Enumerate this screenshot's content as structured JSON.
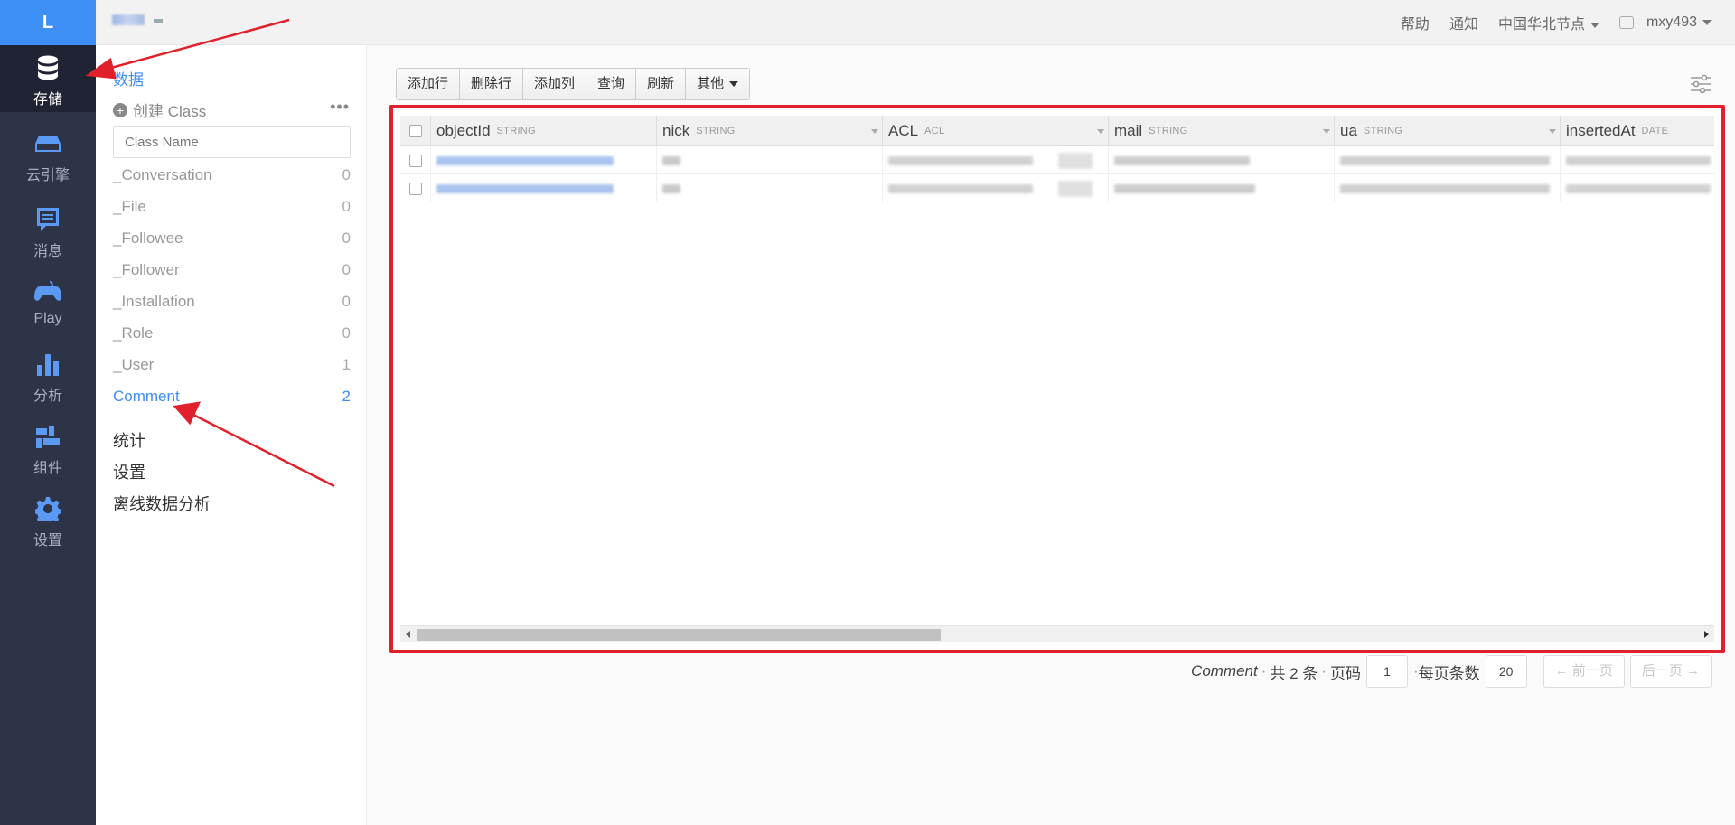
{
  "nav": {
    "logo": "L",
    "items": [
      {
        "label": "存储",
        "icon": "database-icon",
        "active": true
      },
      {
        "label": "云引擎",
        "icon": "cloud-engine-icon"
      },
      {
        "label": "消息",
        "icon": "message-icon"
      },
      {
        "label": "Play",
        "icon": "gamepad-icon"
      },
      {
        "label": "分析",
        "icon": "bar-chart-icon"
      },
      {
        "label": "组件",
        "icon": "components-icon"
      },
      {
        "label": "设置",
        "icon": "gear-icon"
      }
    ]
  },
  "topbar": {
    "help": "帮助",
    "notify": "通知",
    "region": "中国华北节点",
    "user": "mxy493"
  },
  "sidebar": {
    "title": "数据",
    "create_class": "创建 Class",
    "search_placeholder": "Class Name",
    "classes": [
      {
        "name": "_Conversation",
        "count": "0"
      },
      {
        "name": "_File",
        "count": "0"
      },
      {
        "name": "_Followee",
        "count": "0"
      },
      {
        "name": "_Follower",
        "count": "0"
      },
      {
        "name": "_Installation",
        "count": "0"
      },
      {
        "name": "_Role",
        "count": "0"
      },
      {
        "name": "_User",
        "count": "1"
      },
      {
        "name": "Comment",
        "count": "2",
        "active": true
      }
    ],
    "links": [
      "统计",
      "设置",
      "离线数据分析"
    ]
  },
  "toolbar": {
    "add_row": "添加行",
    "delete_row": "删除行",
    "add_column": "添加列",
    "query": "查询",
    "refresh": "刷新",
    "other": "其他"
  },
  "grid": {
    "columns": [
      {
        "name": "objectId",
        "type": "STRING"
      },
      {
        "name": "nick",
        "type": "STRING"
      },
      {
        "name": "ACL",
        "type": "ACL"
      },
      {
        "name": "mail",
        "type": "STRING"
      },
      {
        "name": "ua",
        "type": "STRING"
      },
      {
        "name": "insertedAt",
        "type": "DATE"
      }
    ]
  },
  "pager": {
    "class_name": "Comment",
    "total": "共 2 条",
    "page_label": "页码",
    "page": "1",
    "per_page_label": "每页条数",
    "per_page": "20",
    "prev": "← 前一页",
    "next": "后一页 →"
  },
  "colors": {
    "accent": "#3d8ef5",
    "nav_bg": "#2e3448",
    "annotation": "#e0202a"
  }
}
